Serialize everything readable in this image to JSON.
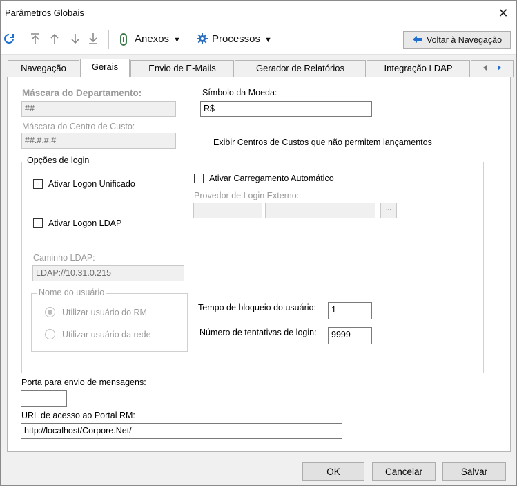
{
  "window": {
    "title": "Parâmetros Globais",
    "close_glyph": "✕"
  },
  "toolbar": {
    "refresh_icon": "refresh-icon",
    "anexos_label": "Anexos",
    "processos_label": "Processos",
    "voltar_label": "Voltar à Navegação",
    "caret": "▼"
  },
  "tabs": [
    {
      "label": "Navegação",
      "active": false
    },
    {
      "label": "Gerais",
      "active": true
    },
    {
      "label": "Envio de E-Mails",
      "active": false
    },
    {
      "label": "Gerador de Relatórios",
      "active": false
    },
    {
      "label": "Integração LDAP",
      "active": false
    }
  ],
  "tab_scroll": {
    "left": "◆",
    "right": "◆"
  },
  "form": {
    "mascara_departamento": {
      "label": "Máscara do Departamento:",
      "value": "##"
    },
    "simbolo_moeda": {
      "label": "Símbolo da Moeda:",
      "value": "R$"
    },
    "mascara_centro_custo": {
      "label": "Máscara do Centro de Custo:",
      "value": "##.#.#.#"
    },
    "exibir_centros": {
      "label": "Exibir Centros de Custos que não permitem lançamentos",
      "checked": false
    },
    "opcoes_login": {
      "title": "Opções de login",
      "logon_unificado": {
        "label": "Ativar Logon Unificado",
        "checked": false
      },
      "carregamento_automatico": {
        "label": "Ativar Carregamento Automático",
        "checked": false
      },
      "provedor_login": {
        "label": "Provedor de Login Externo:",
        "ellipsis": "..."
      },
      "logon_ldap": {
        "label": "Ativar Logon LDAP",
        "checked": false
      },
      "caminho_ldap": {
        "label": "Caminho LDAP:",
        "value": "LDAP://10.31.0.215"
      },
      "nome_usuario": {
        "title": "Nome do usuário",
        "options": [
          "Utilizar usuário do RM",
          "Utilizar usuário da rede"
        ],
        "selected": 0
      },
      "tempo_bloqueio": {
        "label": "Tempo de bloqueio do usuário:",
        "value": "1"
      },
      "tentativas_login": {
        "label": "Número de tentativas de login:",
        "value": "9999"
      }
    },
    "porta_envio": {
      "label": "Porta para envio de mensagens:",
      "value": ""
    },
    "url_portal": {
      "label": "URL de acesso ao Portal RM:",
      "value": "http://localhost/Corpore.Net/"
    }
  },
  "footer": {
    "ok": "OK",
    "cancelar": "Cancelar",
    "salvar": "Salvar"
  },
  "colors": {
    "accent_blue": "#1e6fd0",
    "gear_blue": "#2a6fbe",
    "clip_green": "#3d7a4a"
  }
}
